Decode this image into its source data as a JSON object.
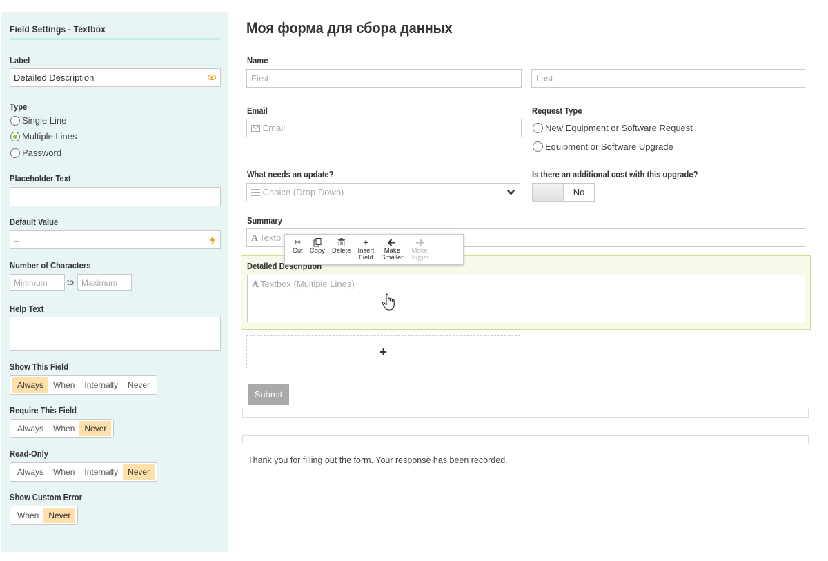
{
  "sidebar": {
    "title": "Field Settings - Textbox",
    "label": {
      "heading": "Label",
      "value": "Detailed Description",
      "icon": "eye-icon"
    },
    "type": {
      "heading": "Type",
      "options": [
        "Single Line",
        "Multiple Lines",
        "Password"
      ],
      "selected": "Multiple Lines"
    },
    "placeholder": {
      "heading": "Placeholder Text",
      "value": ""
    },
    "default_value": {
      "heading": "Default Value",
      "placeholder": "=",
      "icon": "bolt-icon"
    },
    "num_chars": {
      "heading": "Number of Characters",
      "min_placeholder": "Minimum",
      "to": "to",
      "max_placeholder": "Maximum"
    },
    "help_text": {
      "heading": "Help Text",
      "value": ""
    },
    "show_field": {
      "heading": "Show This Field",
      "options": [
        "Always",
        "When",
        "Internally",
        "Never"
      ],
      "selected": "Always"
    },
    "require_field": {
      "heading": "Require This Field",
      "options": [
        "Always",
        "When",
        "Never"
      ],
      "selected": "Never"
    },
    "read_only": {
      "heading": "Read-Only",
      "options": [
        "Always",
        "When",
        "Internally",
        "Never"
      ],
      "selected": "Never"
    },
    "custom_error": {
      "heading": "Show Custom Error",
      "options": [
        "When",
        "Never"
      ],
      "selected": "Never"
    }
  },
  "form": {
    "title": "Моя форма для сбора данных",
    "name": {
      "label": "Name",
      "first_placeholder": "First",
      "last_placeholder": "Last"
    },
    "email": {
      "label": "Email",
      "placeholder": "Email",
      "icon": "envelope-icon"
    },
    "request_type": {
      "label": "Request Type",
      "options": [
        "New Equipment or Software Request",
        "Equipment or Software Upgrade"
      ]
    },
    "update": {
      "label": "What needs an update?",
      "placeholder": "Choice (Drop Down)",
      "icon": "list-icon"
    },
    "additional_cost": {
      "label": "Is there an additional cost with this upgrade?",
      "value": "No"
    },
    "summary": {
      "label": "Summary",
      "placeholder": "Textb",
      "icon_letter": "A"
    },
    "detailed": {
      "label": "Detailed Description",
      "placeholder": "Textbox (Multiple Lines)",
      "icon_letter": "A"
    },
    "add_symbol": "+",
    "submit": "Submit",
    "thanks": "Thank you for filling out the form. Your response has been recorded."
  },
  "toolbar": {
    "cut": "Cut",
    "copy": "Copy",
    "delete": "Delete",
    "insert": [
      "Insert",
      "Field"
    ],
    "smaller": [
      "Make",
      "Smaller"
    ],
    "bigger": [
      "Make",
      "Bigger"
    ]
  },
  "colors": {
    "sidebar_bg": "#e7f5f5",
    "accent_orange": "#ffdfaa",
    "selected_bg": "#f6fbe9",
    "radio_on": "#8dc63f"
  }
}
